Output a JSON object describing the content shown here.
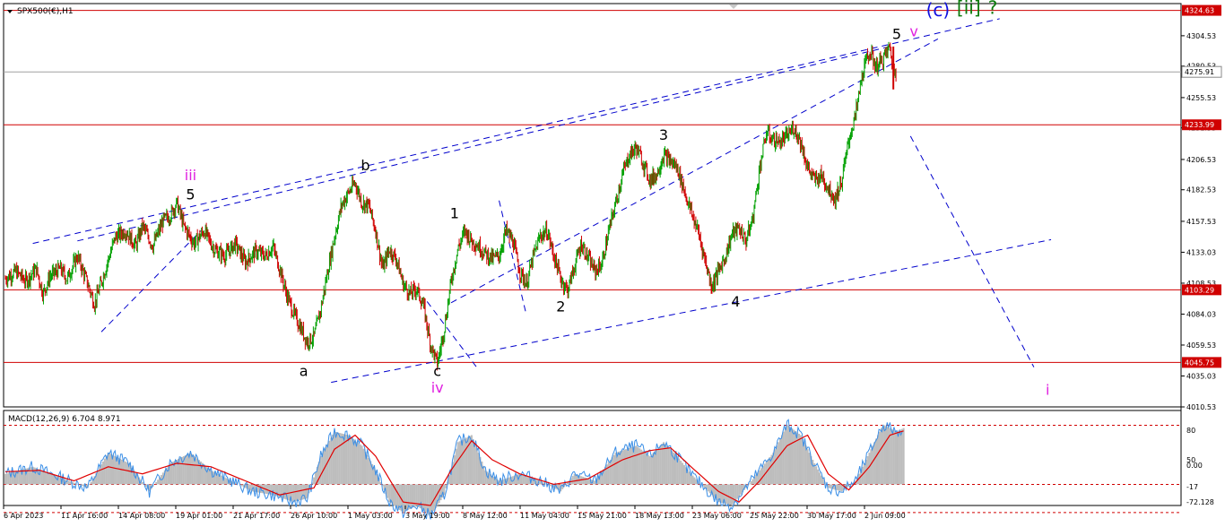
{
  "symbol_label": "SPX500(€),H1",
  "indicator_label": "MACD(12,26,9) 6.704 8.971",
  "colors": {
    "candle_up": "#00a000",
    "candle_down": "#d00000",
    "hline": "#d00000",
    "trend": "#0000cc",
    "price_line": "#a0a0a0",
    "macd_hist": "#bdbdbd",
    "macd_line": "#3a8ee6",
    "signal_line": "#e00000",
    "label_black": "#000000",
    "label_magenta": "#e020e0",
    "label_blue": "#1010e0",
    "label_green": "#0a7a0a"
  },
  "chart_data": [
    {
      "type": "candlestick",
      "panel": "price",
      "ylim": [
        4010.53,
        4330.0
      ],
      "y_ticks": [
        "4304.53",
        "4280.53",
        "4255.53",
        "4231.53",
        "4206.53",
        "4182.53",
        "4157.53",
        "4133.03",
        "4108.53",
        "4084.03",
        "4059.53",
        "4035.03",
        "4010.53"
      ],
      "x_ticks": [
        "6 Apr 2023",
        "11 Apr 16:00",
        "14 Apr 08:00",
        "19 Apr 01:00",
        "21 Apr 17:00",
        "26 Apr 10:00",
        "1 May 03:00",
        "3 May 19:00",
        "8 May 12:00",
        "11 May 04:00",
        "15 May 21:00",
        "18 May 13:00",
        "23 May 06:00",
        "25 May 22:00",
        "30 May 17:00",
        "2 Jun 09:00"
      ],
      "current_price": "4275.91",
      "horizontal_levels": [
        "4324.63",
        "4233.99",
        "4103.29",
        "4045.75"
      ],
      "path_points": [
        [
          0,
          4112
        ],
        [
          3,
          4118
        ],
        [
          6,
          4110
        ],
        [
          9,
          4120
        ],
        [
          11,
          4100
        ],
        [
          13,
          4114
        ],
        [
          16,
          4120
        ],
        [
          18,
          4112
        ],
        [
          21,
          4130
        ],
        [
          24,
          4108
        ],
        [
          26,
          4092
        ],
        [
          29,
          4118
        ],
        [
          32,
          4145
        ],
        [
          35,
          4150
        ],
        [
          38,
          4138
        ],
        [
          40,
          4154
        ],
        [
          43,
          4138
        ],
        [
          46,
          4158
        ],
        [
          48,
          4162
        ],
        [
          50,
          4172
        ],
        [
          52,
          4154
        ],
        [
          55,
          4140
        ],
        [
          58,
          4150
        ],
        [
          61,
          4135
        ],
        [
          64,
          4130
        ],
        [
          67,
          4140
        ],
        [
          70,
          4125
        ],
        [
          73,
          4134
        ],
        [
          76,
          4130
        ],
        [
          78,
          4138
        ],
        [
          80,
          4120
        ],
        [
          82,
          4100
        ],
        [
          84,
          4085
        ],
        [
          86,
          4074
        ],
        [
          88,
          4062
        ],
        [
          90,
          4066
        ],
        [
          92,
          4088
        ],
        [
          94,
          4118
        ],
        [
          96,
          4145
        ],
        [
          98,
          4170
        ],
        [
          100,
          4180
        ],
        [
          102,
          4188
        ],
        [
          104,
          4172
        ],
        [
          106,
          4170
        ],
        [
          108,
          4150
        ],
        [
          110,
          4120
        ],
        [
          112,
          4135
        ],
        [
          114,
          4128
        ],
        [
          116,
          4108
        ],
        [
          118,
          4100
        ],
        [
          120,
          4104
        ],
        [
          122,
          4090
        ],
        [
          124,
          4060
        ],
        [
          126,
          4045
        ],
        [
          128,
          4072
        ],
        [
          130,
          4110
        ],
        [
          132,
          4136
        ],
        [
          134,
          4150
        ],
        [
          136,
          4142
        ],
        [
          138,
          4138
        ],
        [
          140,
          4132
        ],
        [
          142,
          4128
        ],
        [
          144,
          4130
        ],
        [
          146,
          4150
        ],
        [
          148,
          4142
        ],
        [
          150,
          4118
        ],
        [
          152,
          4108
        ],
        [
          154,
          4130
        ],
        [
          156,
          4146
        ],
        [
          158,
          4150
        ],
        [
          160,
          4130
        ],
        [
          162,
          4112
        ],
        [
          164,
          4103
        ],
        [
          166,
          4122
        ],
        [
          168,
          4140
        ],
        [
          170,
          4128
        ],
        [
          172,
          4118
        ],
        [
          174,
          4124
        ],
        [
          176,
          4150
        ],
        [
          178,
          4172
        ],
        [
          180,
          4195
        ],
        [
          182,
          4210
        ],
        [
          184,
          4216
        ],
        [
          186,
          4204
        ],
        [
          188,
          4190
        ],
        [
          190,
          4195
        ],
        [
          192,
          4210
        ],
        [
          194,
          4205
        ],
        [
          196,
          4200
        ],
        [
          198,
          4182
        ],
        [
          200,
          4165
        ],
        [
          202,
          4150
        ],
        [
          204,
          4128
        ],
        [
          206,
          4106
        ],
        [
          208,
          4118
        ],
        [
          210,
          4130
        ],
        [
          212,
          4148
        ],
        [
          214,
          4152
        ],
        [
          216,
          4142
        ],
        [
          218,
          4160
        ],
        [
          220,
          4200
        ],
        [
          222,
          4228
        ],
        [
          224,
          4222
        ],
        [
          226,
          4220
        ],
        [
          228,
          4225
        ],
        [
          230,
          4232
        ],
        [
          232,
          4220
        ],
        [
          234,
          4200
        ],
        [
          236,
          4190
        ],
        [
          238,
          4194
        ],
        [
          240,
          4184
        ],
        [
          242,
          4175
        ],
        [
          244,
          4190
        ],
        [
          246,
          4222
        ],
        [
          248,
          4242
        ],
        [
          250,
          4275
        ],
        [
          252,
          4292
        ],
        [
          254,
          4280
        ],
        [
          256,
          4286
        ],
        [
          258,
          4296
        ],
        [
          259,
          4276
        ]
      ],
      "wave_labels": [
        {
          "text": "iii",
          "color": "magenta",
          "price": 4190,
          "bar": 54
        },
        {
          "text": "5",
          "color": "black",
          "price": 4175,
          "bar": 54
        },
        {
          "text": "a",
          "color": "black",
          "price": 4035,
          "bar": 87
        },
        {
          "text": "b",
          "color": "black",
          "price": 4198,
          "bar": 105
        },
        {
          "text": "c",
          "color": "black",
          "price": 4035,
          "bar": 126
        },
        {
          "text": "iv",
          "color": "magenta",
          "price": 4022,
          "bar": 126
        },
        {
          "text": "1",
          "color": "black",
          "price": 4160,
          "bar": 131
        },
        {
          "text": "2",
          "color": "black",
          "price": 4086,
          "bar": 162
        },
        {
          "text": "3",
          "color": "black",
          "price": 4222,
          "bar": 192
        },
        {
          "text": "4",
          "color": "black",
          "price": 4090,
          "bar": 213
        },
        {
          "text": "5",
          "color": "black",
          "price": 4302,
          "bar": 260
        },
        {
          "text": "v",
          "color": "magenta",
          "price": 4304,
          "bar": 265
        },
        {
          "text": "(c)",
          "color": "blue",
          "price": 4320,
          "bar": 272
        },
        {
          "text": "[ii]",
          "color": "green",
          "price": 4322,
          "bar": 281
        },
        {
          "text": "?",
          "color": "green",
          "price": 4322,
          "bar": 288
        },
        {
          "text": "i",
          "color": "magenta",
          "price": 4020,
          "bar": 304
        }
      ]
    },
    {
      "type": "macd",
      "panel": "indicator",
      "ylim": [
        -30,
        105
      ],
      "y_ticks": [
        "80",
        "50",
        "0.00",
        "-17",
        "-72.128"
      ],
      "reference_levels": [
        84,
        0,
        -40
      ],
      "macd_points": [
        [
          0,
          15
        ],
        [
          8,
          25
        ],
        [
          16,
          10
        ],
        [
          24,
          -5
        ],
        [
          30,
          45
        ],
        [
          36,
          30
        ],
        [
          42,
          -10
        ],
        [
          48,
          30
        ],
        [
          54,
          45
        ],
        [
          60,
          20
        ],
        [
          66,
          5
        ],
        [
          72,
          -10
        ],
        [
          78,
          -15
        ],
        [
          84,
          -25
        ],
        [
          88,
          -20
        ],
        [
          92,
          40
        ],
        [
          96,
          75
        ],
        [
          100,
          70
        ],
        [
          104,
          55
        ],
        [
          108,
          20
        ],
        [
          112,
          -25
        ],
        [
          116,
          -40
        ],
        [
          120,
          -30
        ],
        [
          124,
          -45
        ],
        [
          128,
          -15
        ],
        [
          132,
          60
        ],
        [
          136,
          70
        ],
        [
          140,
          20
        ],
        [
          144,
          5
        ],
        [
          150,
          15
        ],
        [
          156,
          5
        ],
        [
          162,
          -10
        ],
        [
          166,
          15
        ],
        [
          172,
          5
        ],
        [
          178,
          45
        ],
        [
          184,
          55
        ],
        [
          188,
          40
        ],
        [
          192,
          60
        ],
        [
          196,
          40
        ],
        [
          200,
          15
        ],
        [
          204,
          -5
        ],
        [
          208,
          -25
        ],
        [
          212,
          -30
        ],
        [
          216,
          -5
        ],
        [
          220,
          20
        ],
        [
          224,
          45
        ],
        [
          228,
          85
        ],
        [
          232,
          70
        ],
        [
          236,
          30
        ],
        [
          240,
          -5
        ],
        [
          244,
          -10
        ],
        [
          248,
          5
        ],
        [
          252,
          45
        ],
        [
          256,
          85
        ],
        [
          260,
          75
        ],
        [
          262,
          80
        ]
      ],
      "signal_points": [
        [
          0,
          18
        ],
        [
          10,
          20
        ],
        [
          20,
          5
        ],
        [
          30,
          25
        ],
        [
          40,
          15
        ],
        [
          50,
          30
        ],
        [
          60,
          25
        ],
        [
          70,
          5
        ],
        [
          80,
          -15
        ],
        [
          90,
          -5
        ],
        [
          96,
          50
        ],
        [
          102,
          70
        ],
        [
          108,
          40
        ],
        [
          116,
          -25
        ],
        [
          124,
          -30
        ],
        [
          130,
          20
        ],
        [
          136,
          62
        ],
        [
          142,
          35
        ],
        [
          150,
          15
        ],
        [
          160,
          0
        ],
        [
          170,
          8
        ],
        [
          180,
          35
        ],
        [
          188,
          48
        ],
        [
          194,
          52
        ],
        [
          200,
          25
        ],
        [
          208,
          -10
        ],
        [
          214,
          -25
        ],
        [
          220,
          5
        ],
        [
          228,
          55
        ],
        [
          234,
          70
        ],
        [
          240,
          15
        ],
        [
          246,
          -8
        ],
        [
          252,
          25
        ],
        [
          258,
          70
        ],
        [
          262,
          76
        ]
      ]
    }
  ]
}
